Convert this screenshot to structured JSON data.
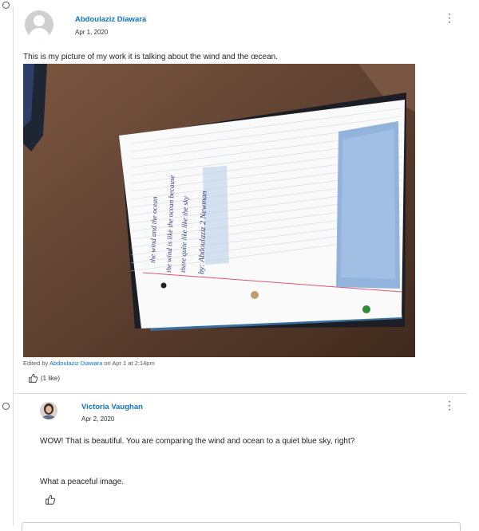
{
  "post": {
    "author": "Abdoulaziz Diawara",
    "date": "Apr 1, 2020",
    "text": "This is my picture of my work it is talking about the wind and the œcean.",
    "image_handwriting": [
      "the wind and the ocean",
      "the wind is like the ocean because",
      "there quite like like the sky",
      "by: Abdoulaziz  2  Newman"
    ],
    "edited_prefix": "Edited by",
    "edited_by": "Abdoulaziz Diawara",
    "edited_suffix": "on Apr 1 at 2:14pm",
    "likes": "(1 like)"
  },
  "reply": {
    "author": "Victoria Vaughan",
    "date": "Apr 2, 2020",
    "text1": "WOW! That is beautiful. You are comparing the wind and ocean to a quiet blue sky, right?",
    "text2": "What a peaceful image."
  },
  "icons": {
    "menu": "kebab-menu-icon",
    "like": "thumbs-up-icon",
    "avatar": "default-avatar-icon"
  },
  "colors": {
    "link": "#0b74c4",
    "text": "#222222"
  }
}
